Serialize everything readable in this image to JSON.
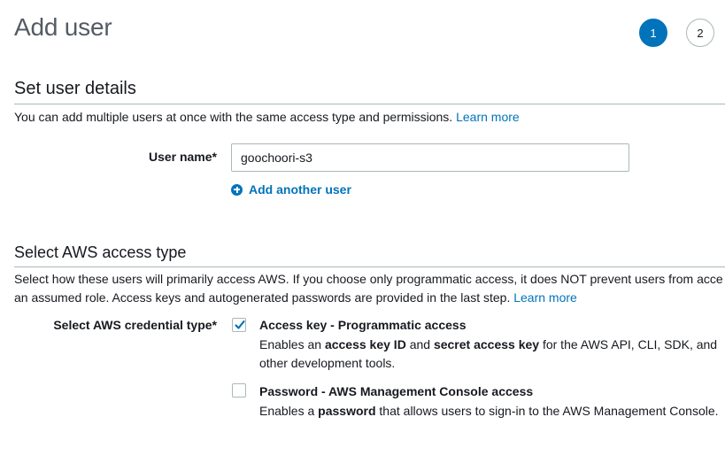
{
  "header": {
    "title": "Add user",
    "steps": [
      "1",
      "2"
    ]
  },
  "details": {
    "section_title": "Set user details",
    "description": "You can add multiple users at once with the same access type and permissions.",
    "learn_more": "Learn more",
    "username_label": "User name*",
    "username_value": "goochoori-s3",
    "add_another": "Add another user"
  },
  "access": {
    "section_title": "Select AWS access type",
    "description_line1": "Select how these users will primarily access AWS. If you choose only programmatic access, it does NOT prevent users from acce",
    "description_line2": "an assumed role. Access keys and autogenerated passwords are provided in the last step.",
    "learn_more": "Learn more",
    "credential_label": "Select AWS credential type*",
    "options": [
      {
        "title": "Access key - Programmatic access",
        "checked": true,
        "desc_line1": [
          "Enables an ",
          "access key ID",
          " and ",
          "secret access key",
          " for the AWS API, CLI, SDK, and"
        ],
        "desc_line2": "other development tools."
      },
      {
        "title": "Password - AWS Management Console access",
        "checked": false,
        "desc_line1": [
          "Enables a ",
          "password",
          " that allows users to sign-in to the AWS Management Console."
        ]
      }
    ]
  },
  "colors": {
    "accent": "#0073bb",
    "border": "#aab7b8",
    "text": "#16191f",
    "muted": "#545b64"
  }
}
